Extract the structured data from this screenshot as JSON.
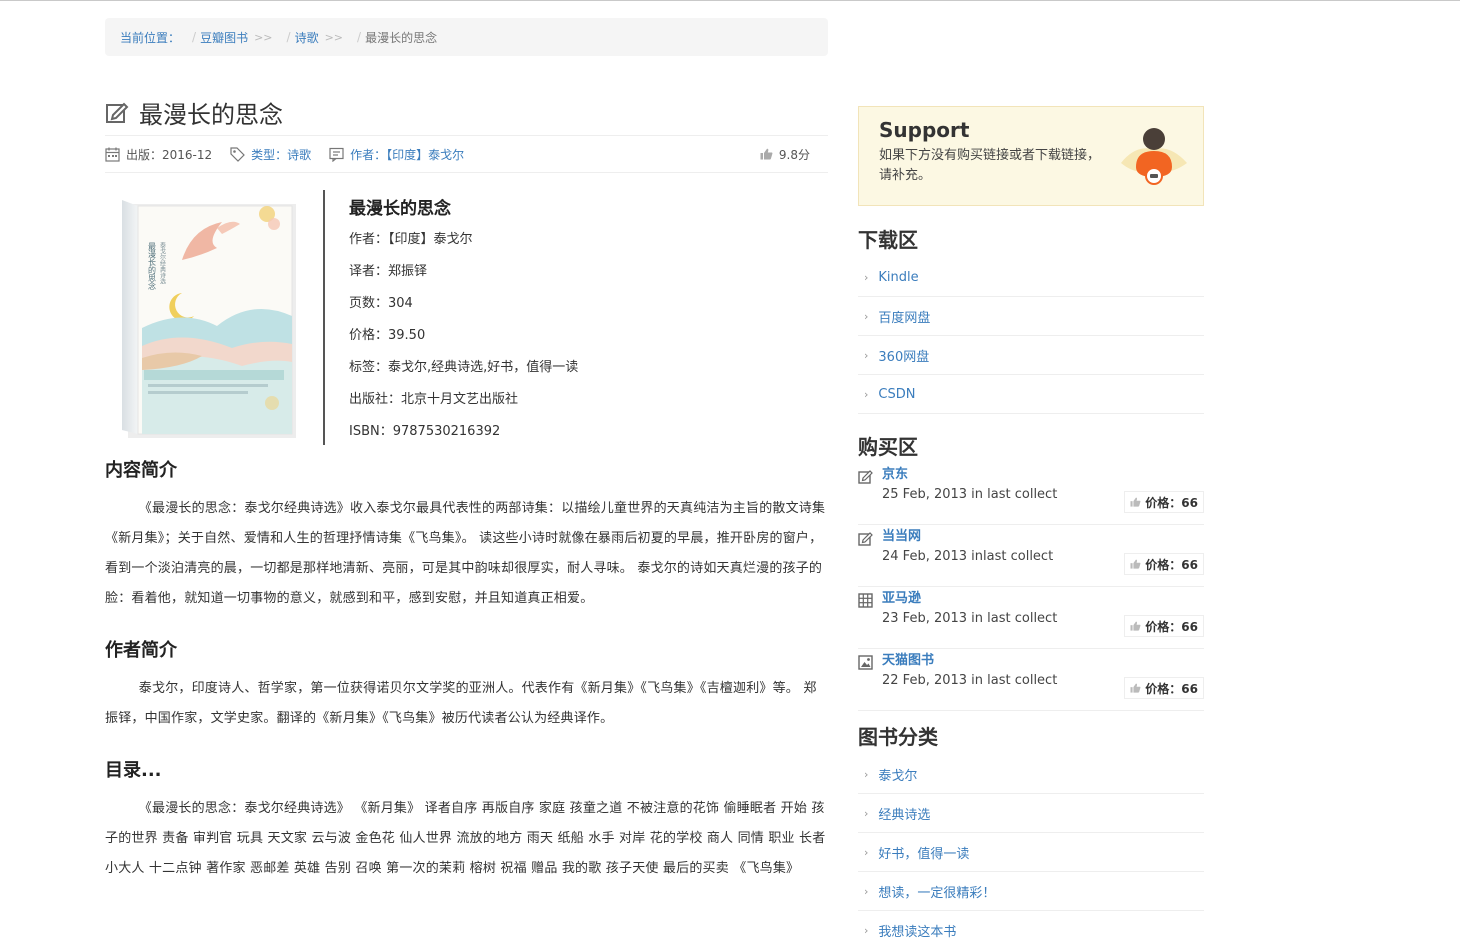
{
  "breadcrumb": {
    "label": "当前位置：",
    "items": [
      "豆瓣图书",
      "诗歌"
    ],
    "current": "最漫长的思念"
  },
  "book": {
    "title": "最漫长的思念",
    "meta": {
      "publish": "出版：2016-12",
      "category": "类型：诗歌",
      "author": "作者：【印度】泰戈尔",
      "score": "9.8分"
    },
    "cover_text": {
      "title": "最漫长的思念",
      "subtitle": "泰戈尔经典诗选"
    },
    "info": {
      "name": "最漫长的思念",
      "rows": [
        "作者：【印度】泰戈尔",
        "译者：郑振铎",
        "页数：304",
        "价格：39.50",
        "标签：泰戈尔,经典诗选,好书，值得一读",
        "出版社：北京十月文艺出版社",
        "ISBN：9787530216392"
      ]
    }
  },
  "sections": {
    "intro_title": "内容简介",
    "intro_text": "《最漫长的思念：泰戈尔经典诗选》收入泰戈尔最具代表性的两部诗集：以描绘儿童世界的天真纯洁为主旨的散文诗集《新月集》；关于自然、爱情和人生的哲理抒情诗集《飞鸟集》。 读这些小诗时就像在暴雨后初夏的早晨，推开卧房的窗户，看到一个淡泊清亮的晨，一切都是那样地清新、亮丽，可是其中韵味却很厚实，耐人寻味。 泰戈尔的诗如天真烂漫的孩子的脸：看着他，就知道一切事物的意义，就感到和平，感到安慰，并且知道真正相爱。",
    "author_title": "作者简介",
    "author_text": "泰戈尔，印度诗人、哲学家，第一位获得诺贝尔文学奖的亚洲人。代表作有《新月集》《飞鸟集》《吉檀迦利》等。 郑振铎，中国作家，文学史家。翻译的《新月集》《飞鸟集》被历代读者公认为经典译作。",
    "toc_title": "目录...",
    "toc_text": "《最漫长的思念：泰戈尔经典诗选》 《新月集》 译者自序 再版自序 家庭 孩童之道 不被注意的花饰 偷睡眠者 开始 孩子的世界 责备 审判官 玩具 天文家 云与波 金色花 仙人世界 流放的地方 雨天 纸船 水手 对岸 花的学校 商人 同情 职业 长者 小大人 十二点钟 著作家 恶邮差 英雄 告别 召唤 第一次的茉莉 榕树 祝福 赠品 我的歌 孩子天使 最后的买卖 《飞鸟集》"
  },
  "sidebar": {
    "support": {
      "title": "Support",
      "desc": "如果下方没有购买链接或者下载链接，请补充。"
    },
    "download_title": "下载区",
    "downloads": [
      "Kindle",
      "百度网盘",
      "360网盘",
      "CSDN"
    ],
    "buy_title": "购买区",
    "buy": [
      {
        "name": "京东",
        "date": "25 Feb, 2013 in last collect",
        "price": "价格：66",
        "icon": "edit-icon"
      },
      {
        "name": "当当网",
        "date": "24 Feb, 2013 inlast collect",
        "price": "价格：66",
        "icon": "edit-icon"
      },
      {
        "name": "亚马逊",
        "date": "23 Feb, 2013 in last collect",
        "price": "价格：66",
        "icon": "grid-icon"
      },
      {
        "name": "天猫图书",
        "date": "22 Feb, 2013 in last collect",
        "price": "价格：66",
        "icon": "picture-icon"
      }
    ],
    "category_title": "图书分类",
    "categories": [
      "泰戈尔",
      "经典诗选",
      "好书，值得一读",
      "想读，一定很精彩！",
      "我想读这本书"
    ]
  },
  "colors": {
    "link": "#3b7dbd",
    "support_bg": "#fcf8e3",
    "avatar_orange": "#f26522"
  }
}
